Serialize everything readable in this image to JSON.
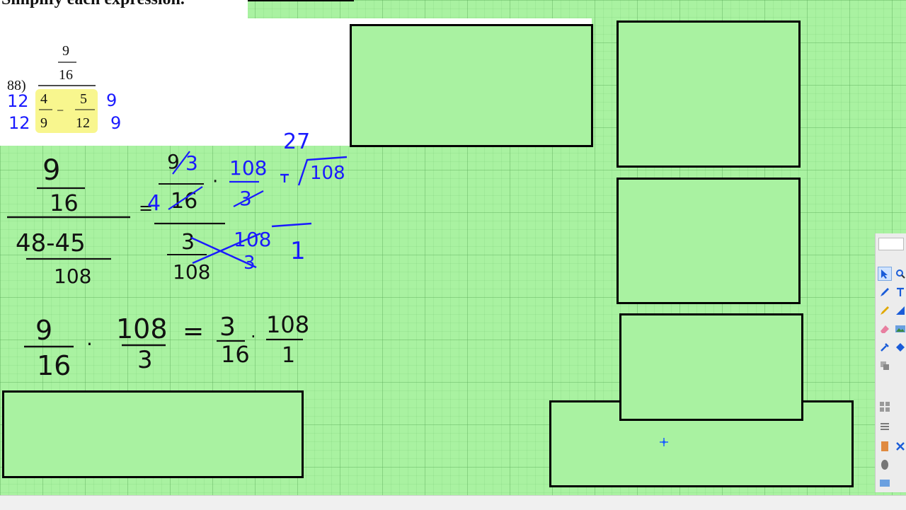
{
  "header": {
    "title": "Simplify each expression."
  },
  "problem": {
    "number": "88)",
    "top_num": "9",
    "top_den": "16",
    "a_num": "4",
    "a_den": "9",
    "op": "−",
    "b_num": "5",
    "b_den": "12",
    "multiplier_left": "12",
    "multiplier_right": "9"
  },
  "work": {
    "step1_top_num": "9",
    "step1_top_den": "16",
    "step1_bottom_num": "48-45",
    "step1_bottom_den": "108",
    "eq": "=",
    "step2_num": "9",
    "step2_num_reduced": "3",
    "step2_den": "16",
    "step2_den_prefix": "4",
    "dot": "·",
    "step2_mult_num": "108",
    "step2_mult_den": "3",
    "step2_bottom_num": "3",
    "step2_bottom_den": "108",
    "step2_cross_num": "108",
    "step2_cross_den": "3",
    "side_quotient": "27",
    "side_divisor": "3",
    "side_dividend": "108",
    "side_one": "1",
    "row2_a_num": "9",
    "row2_a_den": "16",
    "row2_b_num": "108",
    "row2_b_den": "3",
    "row2_c_num": "3",
    "row2_c_den": "16",
    "row2_d_num": "108",
    "row2_d_den": "1"
  },
  "colors": {
    "board": "#a9f2a1",
    "ink_black": "#111111",
    "ink_blue": "#1a1aff",
    "highlight": "#f7f57a",
    "paper": "#ffffff"
  },
  "toolbar": {
    "tools": [
      "select-arrow-icon",
      "zoom-icon",
      "pen-icon",
      "text-icon",
      "highlighter-icon",
      "fill-icon",
      "eraser-icon",
      "image-icon",
      "eyedropper-icon",
      "shape-icon",
      "gallery-icon",
      "page-icon"
    ]
  }
}
